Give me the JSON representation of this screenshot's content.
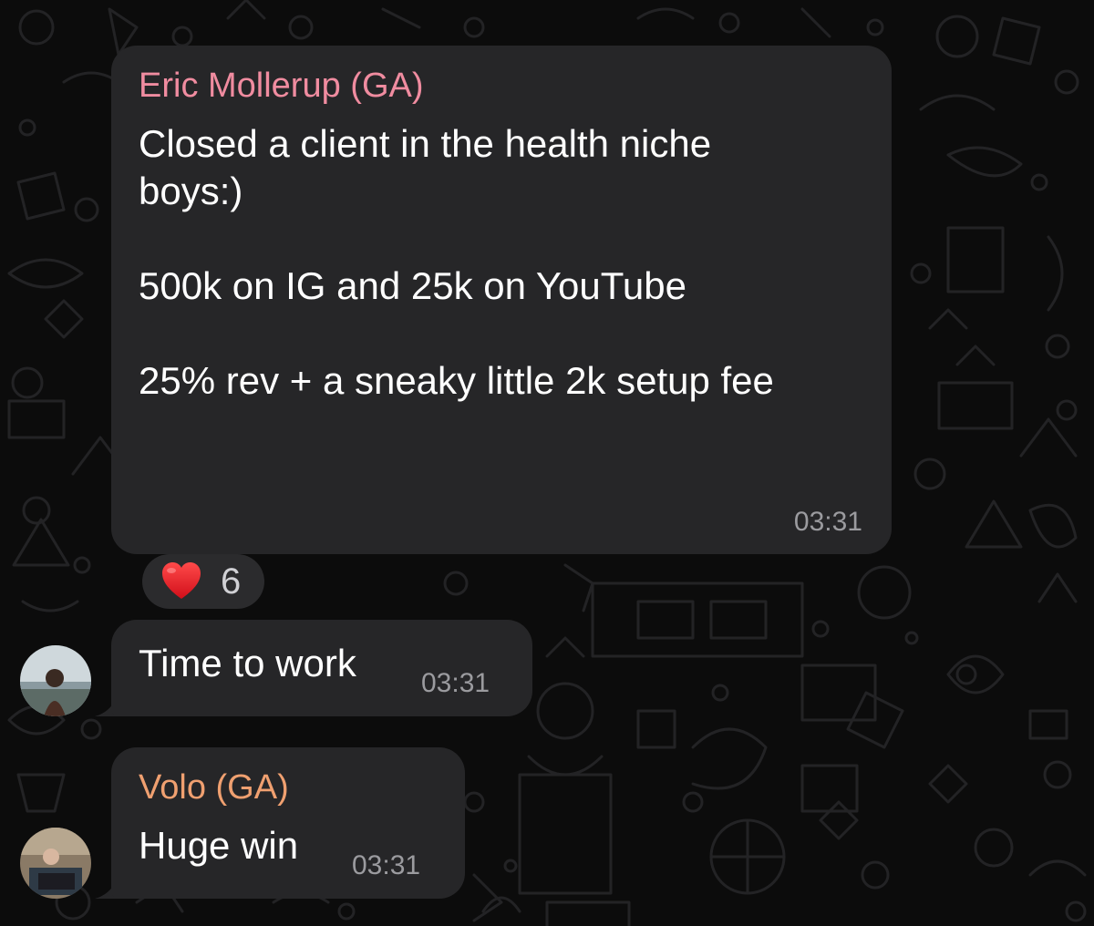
{
  "chat": {
    "background_color": "#0c0c0c",
    "bubble_color": "#262628",
    "messages": [
      {
        "sender": "Eric Mollerup (GA)",
        "sender_color": "#f08ca0",
        "text": "Closed a client in the health niche\nboys:)\n\n500k on IG and 25k on YouTube\n\n25% rev + a sneaky little 2k setup fee",
        "time": "03:31",
        "reaction": {
          "emoji": "heart",
          "count": "6"
        }
      },
      {
        "text": "Time to work",
        "time": "03:31",
        "avatar": "user-photo-avatar"
      },
      {
        "sender": "Volo (GA)",
        "sender_color": "#f0a070",
        "text": "Huge win",
        "time": "03:31",
        "avatar": "user-photo-avatar"
      }
    ]
  }
}
